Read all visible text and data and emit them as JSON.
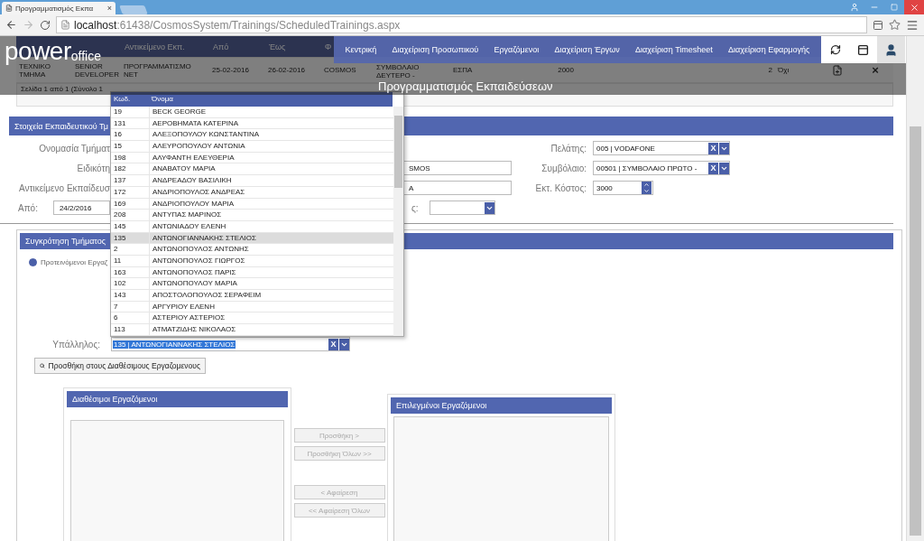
{
  "browser": {
    "tab_title": "Προγραμματισμός Εκπα",
    "tab_close": "×",
    "url_host": "localhost",
    "url_path": ":61438/CosmosSystem/Trainings/ScheduledTrainings.aspx"
  },
  "header": {
    "logo_main": "power",
    "logo_sub": "office",
    "title": "Προγραμματισμός Εκπαιδεύσεων",
    "nav": [
      "Κεντρική",
      "Διαχείριση Προσωπικού",
      "Εργαζόμενοι",
      "Διαχείριση Έργων",
      "Διαχείριση Timesheet",
      "Διαχείριση Εφαρμογής"
    ]
  },
  "grid": {
    "columns": [
      "Αντικείμενο Εκπ.",
      "Από",
      "Έως",
      "Φ"
    ],
    "cells": [
      "ΤΕΧΝΙΚΟ ΤΜΗΜΑ",
      "SENIOR DEVELOPER",
      "ΠΡΟΓΡΑΜΜΑΤΙΣΜΟ NET",
      "25-02-2016",
      "26-02-2016",
      "COSMOS",
      "ΣΥΜΒΟΛΑΙΟ ΔΕΥΤΕΡΟ -",
      "ΕΣΠΑ",
      "2000",
      "2",
      "Όχι"
    ],
    "delete_mark": "×",
    "pager": "Σελίδα 1 από 1 (Σύνολο 1"
  },
  "form_section": {
    "title": "Στοιχεία Εκπαιδευτικού Τμ",
    "rows": [
      {
        "label": "Ονομασία Τμήματ",
        "right_label": "Πελάτης:",
        "kind": "combo",
        "right_value": "005 | VODAFONE",
        "clear": "X"
      },
      {
        "label": "Ειδικότη",
        "middle_value": "SMOS",
        "right_label": "Συμβόλαιο:",
        "kind": "combo",
        "right_value": "00501 | ΣΥΜΒΟΛΑΙΟ ΠΡΩΤΟ -",
        "clear": "X"
      },
      {
        "label": "Αντικείμενο Εκπαίδευσ",
        "middle_value": "Α",
        "right_label": "Εκτ. Κόστος:",
        "kind": "spinner",
        "right_value": "3000"
      }
    ],
    "date_row": {
      "label": "Από:",
      "value": "24/2/2016",
      "other_label": "ς:"
    }
  },
  "team_section": {
    "title": "Συγκρότηση Τμήματος",
    "radio": {
      "label": "Προτεινόμενοι Εργαζ",
      "checked": true
    },
    "employee": {
      "label": "Υπάλληλος:",
      "value": "135 | ΑΝΤΩΝΟΓΙΑΝΝΑΚΗΣ ΣΤΕΛΙΟΣ",
      "clear": "X"
    },
    "add_button": "Προσθήκη στους Διαθέσιμους Εργαζομενους",
    "available_title": "Διαθέσιμοι Εργαζόμενοι",
    "chosen_title": "Επιλεγμένοι Εργαζόμενοι",
    "transfer_buttons": [
      {
        "label": "Προσθήκη >",
        "disabled": true
      },
      {
        "label": "Προσθήκη Όλων >>",
        "disabled": true
      },
      {
        "label": "< Αφαίρεση",
        "disabled": true
      },
      {
        "label": "<< Αφαίρεση Όλων",
        "disabled": true
      }
    ]
  },
  "dropdown": {
    "columns": [
      "Κωδ.",
      "Όνομα"
    ],
    "items": [
      {
        "code": "19",
        "name": "BECK GEORGE",
        "selected": false
      },
      {
        "code": "131",
        "name": "ΑΕΡΟΒΗΜΑΤΑ ΚΑΤΕΡΙΝΑ",
        "selected": false
      },
      {
        "code": "16",
        "name": "ΑΛΕΞΟΠΟΥΛΟΥ ΚΩΝΣΤΑΝΤΙΝΑ",
        "selected": false
      },
      {
        "code": "15",
        "name": "ΑΛΕΥΡΟΠΟΥΛΟΥ ΑΝΤΩΝΙΑ",
        "selected": false
      },
      {
        "code": "198",
        "name": "ΑΛΥΦΑΝΤΗ ΕΛΕΥΘΕΡΙΑ",
        "selected": false
      },
      {
        "code": "182",
        "name": "ΑΝΑΒΑΤΟΥ ΜΑΡΙΑ",
        "selected": false
      },
      {
        "code": "137",
        "name": "ΑΝΔΡΕΑΔΟΥ ΒΑΣΙΛΙΚΗ",
        "selected": false
      },
      {
        "code": "172",
        "name": "ΑΝΔΡΙΟΠΟΥΛΟΣ ΑΝΔΡΕΑΣ",
        "selected": false
      },
      {
        "code": "169",
        "name": "ΑΝΔΡΙΟΠΟΥΛΟΥ ΜΑΡΙΑ",
        "selected": false
      },
      {
        "code": "208",
        "name": "ΑΝΤΥΠΑΣ ΜΑΡΙΝΟΣ",
        "selected": false
      },
      {
        "code": "145",
        "name": "ΑΝΤΩΝΙΑΔΟΥ ΕΛΕΝΗ",
        "selected": false
      },
      {
        "code": "135",
        "name": "ΑΝΤΩΝΟΓΙΑΝΝΑΚΗΣ ΣΤΕΛΙΟΣ",
        "selected": true
      },
      {
        "code": "2",
        "name": "ΑΝΤΩΝΟΠΟΥΛΟΣ ΑΝΤΩΝΗΣ",
        "selected": false
      },
      {
        "code": "11",
        "name": "ΑΝΤΩΝΟΠΟΥΛΟΣ ΓΙΩΡΓΟΣ",
        "selected": false
      },
      {
        "code": "163",
        "name": "ΑΝΤΩΝΟΠΟΥΛΟΣ ΠΑΡΙΣ",
        "selected": false
      },
      {
        "code": "102",
        "name": "ΑΝΤΩΝΟΠΟΥΛΟΥ ΜΑΡΙΑ",
        "selected": false
      },
      {
        "code": "143",
        "name": "ΑΠΟΣΤΟΛΟΠΟΥΛΟΣ ΣΕΡΑΦΕΙΜ",
        "selected": false
      },
      {
        "code": "7",
        "name": "ΑΡΓΥΡΙΟΥ ΕΛΕΝΗ",
        "selected": false
      },
      {
        "code": "6",
        "name": "ΑΣΤΕΡΙΟΥ ΑΣΤΕΡΙΟΣ",
        "selected": false
      },
      {
        "code": "113",
        "name": "ΑΤΜΑΤΖΙΔΗΣ ΝΙΚΟΛΑΟΣ",
        "selected": false
      }
    ]
  }
}
